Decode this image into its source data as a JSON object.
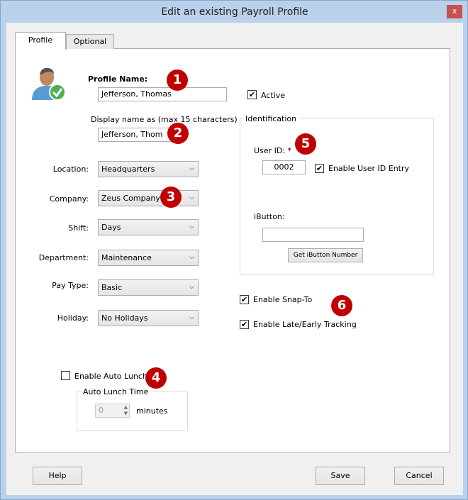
{
  "window": {
    "title": "Edit an existing Payroll Profile",
    "close": "x"
  },
  "tabs": [
    {
      "label": "Profile",
      "active": true
    },
    {
      "label": "Optional",
      "active": false
    }
  ],
  "profile": {
    "name_label": "Profile Name:",
    "name_value": "Jefferson, Thomas",
    "display_label": "Display name as (max 15 characters)",
    "display_value": "Jefferson, Thom",
    "active_label": "Active",
    "active_checked": true
  },
  "fields": [
    {
      "label": "Location:",
      "value": "Headquarters"
    },
    {
      "label": "Company:",
      "value": "Zeus Company"
    },
    {
      "label": "Shift:",
      "value": "Days"
    },
    {
      "label": "Department:",
      "value": "Maintenance"
    },
    {
      "label": "Pay Type:",
      "value": "Basic"
    },
    {
      "label": "Holiday:",
      "value": "No Holidays"
    }
  ],
  "identification": {
    "title": "Identification",
    "user_id_label": "User ID: *",
    "user_id_value": "0002",
    "enable_user_id_label": "Enable User ID Entry",
    "enable_user_id_checked": true,
    "ibutton_label": "iButton:",
    "ibutton_value": "",
    "get_ibutton_label": "Get iButton Number"
  },
  "options": {
    "snap_label": "Enable Snap-To",
    "snap_checked": true,
    "late_label": "Enable Late/Early Tracking",
    "late_checked": true
  },
  "auto_lunch": {
    "enable_label": "Enable Auto Lunch",
    "enabled": false,
    "group_title": "Auto Lunch Time",
    "value": "0",
    "unit": "minutes"
  },
  "badges": [
    "1",
    "2",
    "3",
    "4",
    "5",
    "6"
  ],
  "buttons": {
    "help": "Help",
    "save": "Save",
    "cancel": "Cancel"
  },
  "colors": {
    "badge": "#c00000",
    "titlebar": "#b9d1ea"
  },
  "check_glyph": "✔"
}
